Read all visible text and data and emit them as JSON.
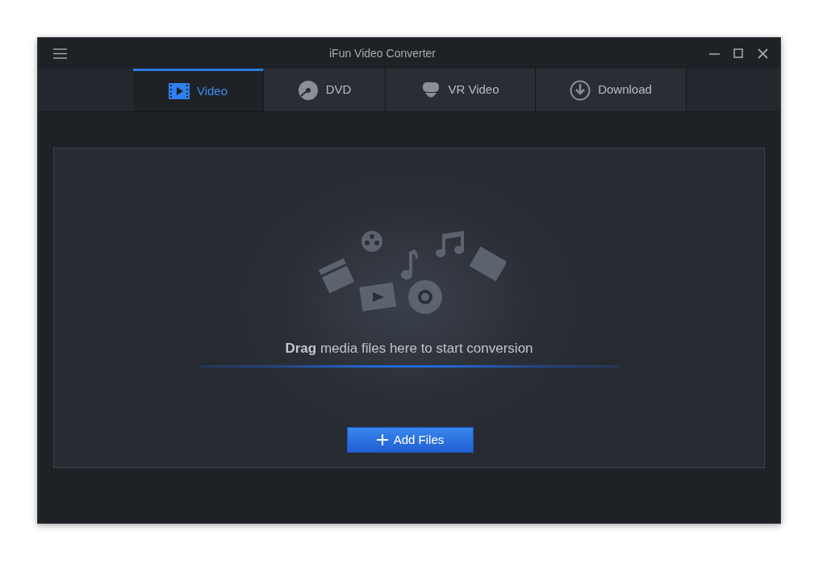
{
  "window": {
    "title": "iFun Video Converter"
  },
  "tabs": [
    {
      "label": "Video",
      "kind": "video",
      "selected": true
    },
    {
      "label": "DVD",
      "kind": "dvd",
      "selected": false
    },
    {
      "label": "VR Video",
      "kind": "vr",
      "selected": false
    },
    {
      "label": "Download",
      "kind": "download",
      "selected": false
    }
  ],
  "drop_zone": {
    "message": "**Drag** media files here to start conversion",
    "button": "Add Files"
  }
}
